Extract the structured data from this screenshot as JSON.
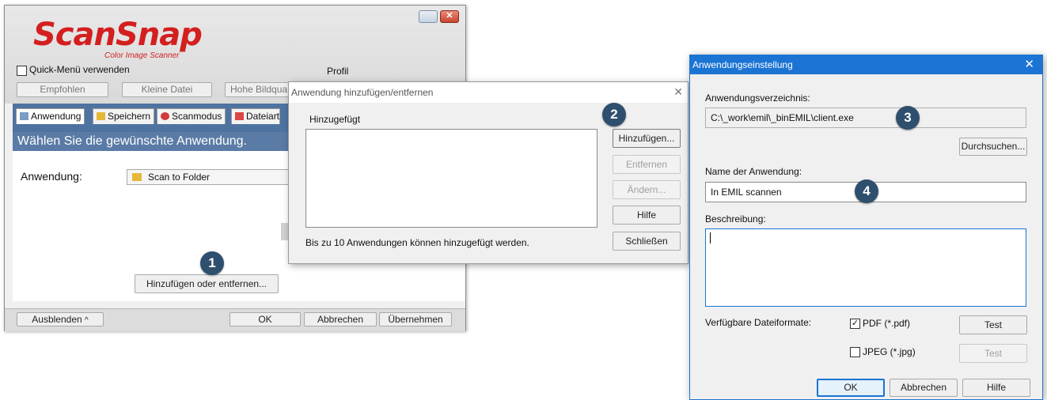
{
  "scansnap": {
    "logo_text": "ScanSnap",
    "logo_sub": "Color Image Scanner",
    "quick_menu_label": "Quick-Menü verwenden",
    "profile_label": "Profil",
    "profile_buttons": [
      "Empfohlen",
      "Kleine Datei",
      "Hohe Bildqua"
    ],
    "tabs": [
      "Anwendung",
      "Speichern",
      "Scanmodus",
      "Dateiart"
    ],
    "banner": "Wählen Sie die gewünschte Anwendung.",
    "app_label": "Anwendung:",
    "app_value": "Scan to Folder",
    "add_remove_button": "Hinzufügen oder entfernen...",
    "hide_button": "Ausblenden",
    "ok_button": "OK",
    "cancel_button": "Abbrechen",
    "apply_button": "Übernehmen"
  },
  "add_remove_dialog": {
    "title": "Anwendung hinzufügen/entfernen",
    "list_label": "Hinzugefügt",
    "note": "Bis zu 10 Anwendungen können hinzugefügt werden.",
    "buttons": {
      "add": "Hinzufügen...",
      "remove": "Entfernen",
      "change": "Ändern...",
      "help": "Hilfe",
      "close": "Schließen"
    }
  },
  "app_settings_dialog": {
    "title": "Anwendungseinstellung",
    "dir_label": "Anwendungsverzeichnis:",
    "dir_value": "C:\\_work\\emil\\_binEMIL\\client.exe",
    "browse_button": "Durchsuchen...",
    "name_label": "Name der Anwendung:",
    "name_value": "In EMIL scannen",
    "desc_label": "Beschreibung:",
    "formats_label": "Verfügbare Dateiformate:",
    "pdf_label": "PDF (*.pdf)",
    "pdf_checked": true,
    "jpeg_label": "JPEG (*.jpg)",
    "jpeg_checked": false,
    "test_button": "Test",
    "ok_button": "OK",
    "cancel_button": "Abbrechen",
    "help_button": "Hilfe"
  },
  "badges": [
    "1",
    "2",
    "3",
    "4"
  ],
  "colors": {
    "badge": "#2f4f6e",
    "scansnap_red": "#d31f1f",
    "banner_blue": "#5a7ba6",
    "win10_title_blue": "#1b74d4"
  }
}
